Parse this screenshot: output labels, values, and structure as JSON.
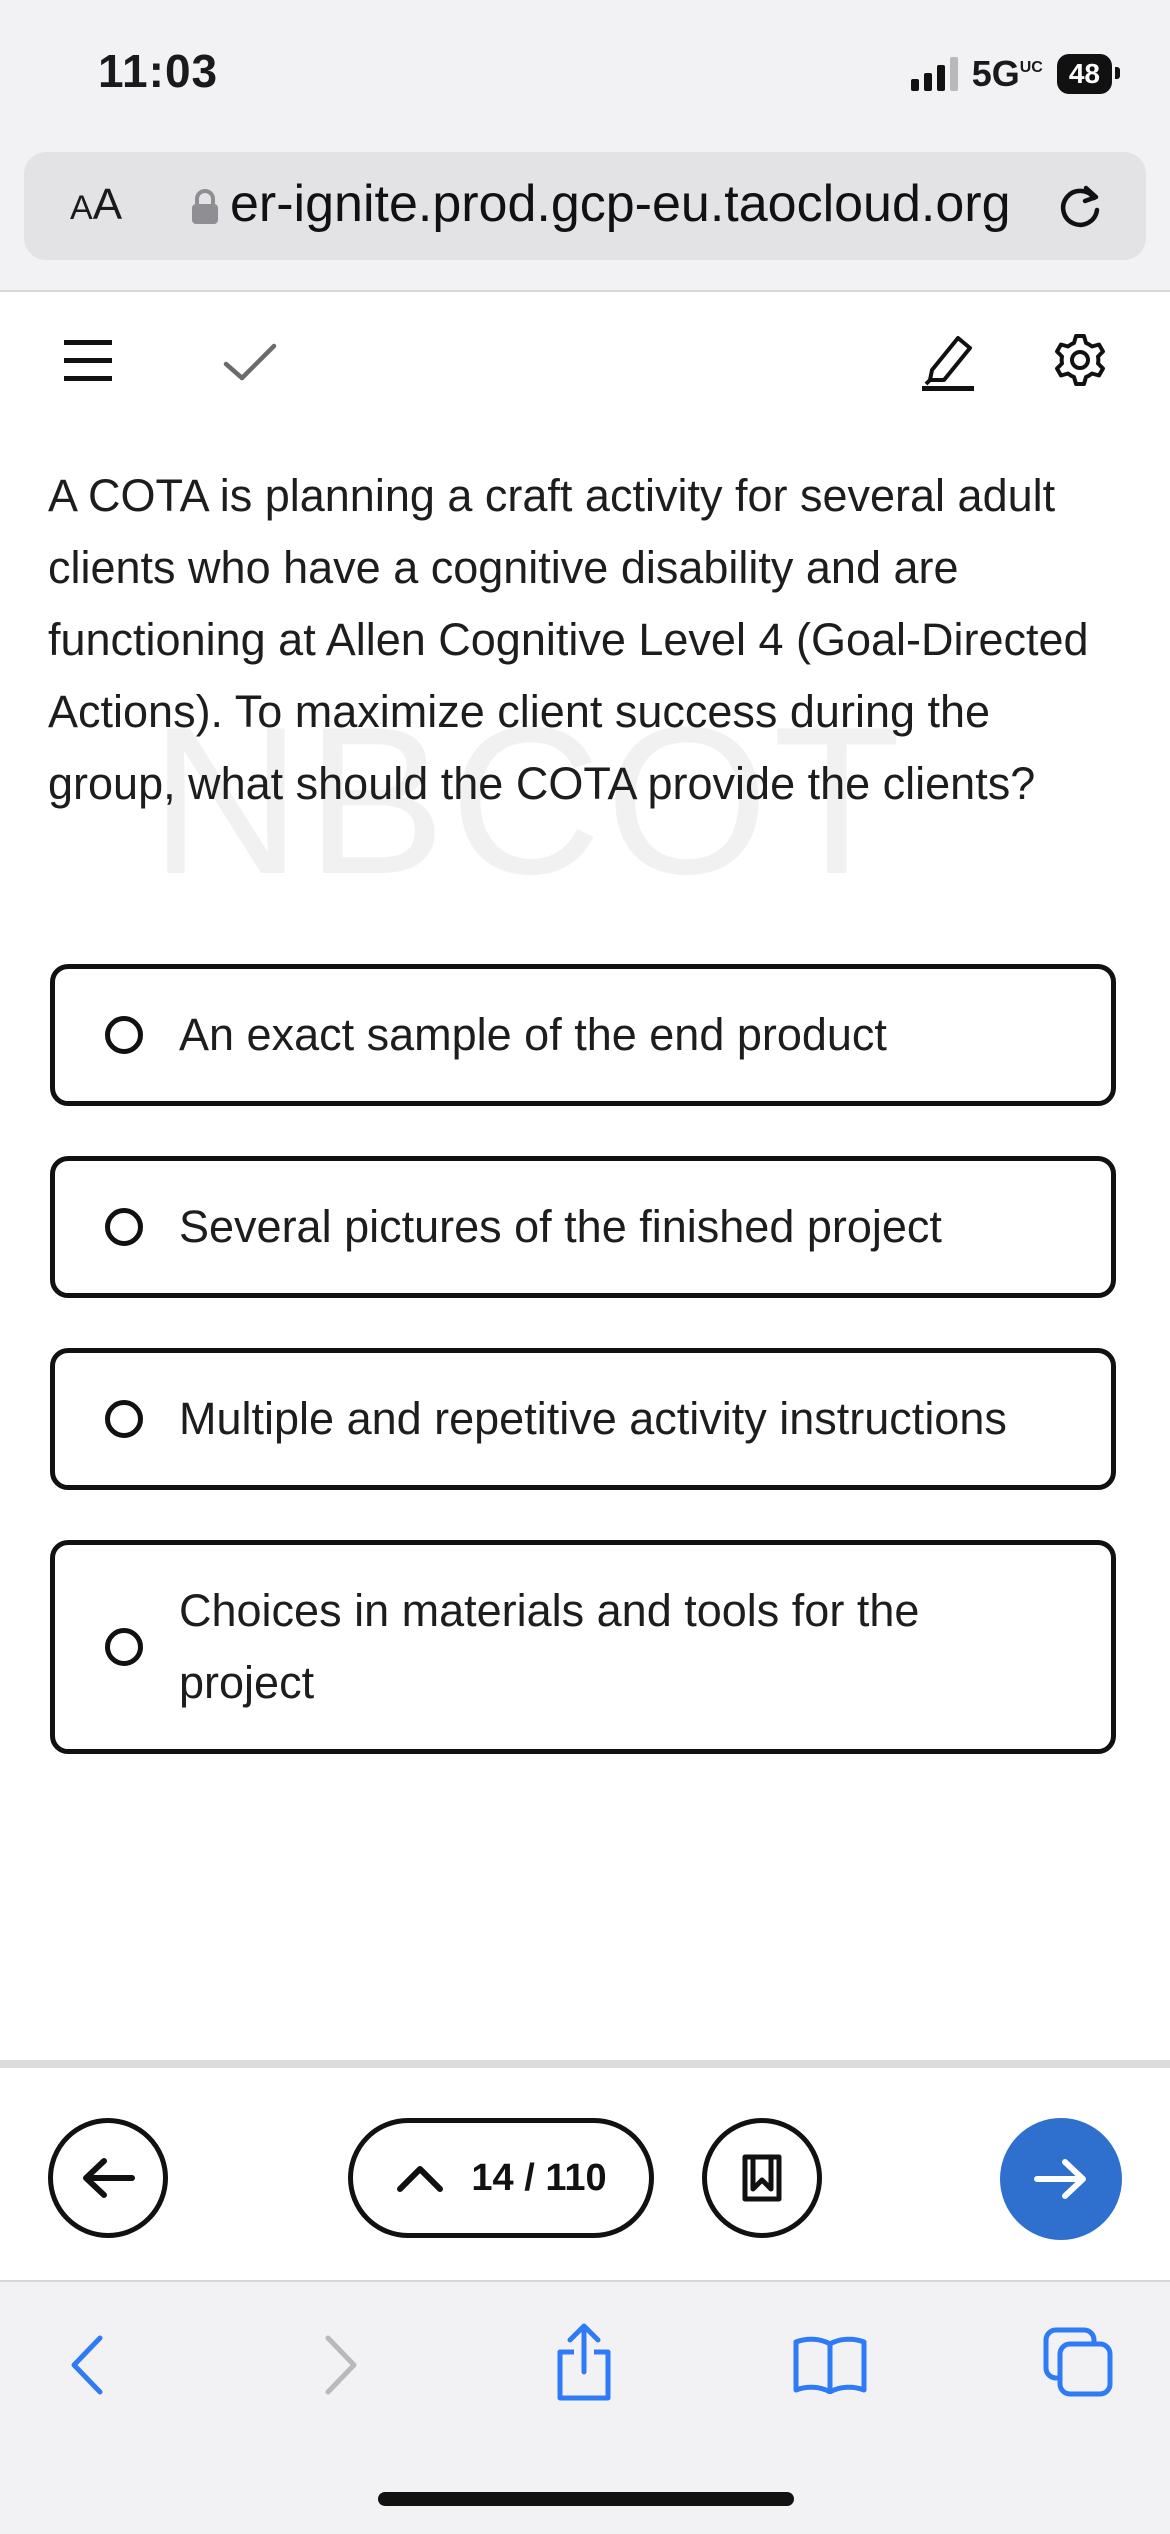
{
  "status_bar": {
    "time": "11:03",
    "network": "5G",
    "network_superscript": "UC",
    "battery": "48"
  },
  "browser": {
    "text_size_label_small": "A",
    "text_size_label_large": "A",
    "url": "er-ignite.prod.gcp-eu.taocloud.org"
  },
  "toolbar": {
    "icons": [
      "menu-icon",
      "checkmark-icon",
      "highlighter-icon",
      "gear-icon"
    ]
  },
  "question": {
    "text": "A COTA is planning a craft activity for several adult clients who have a cognitive disability and are functioning at Allen Cognitive Level 4 (Goal-Directed Actions). To maximize client success during the group, what should the COTA provide the clients?",
    "watermark": "NBCOT"
  },
  "options": [
    {
      "label": "An exact sample of the end product"
    },
    {
      "label": "Several pictures of the finished project"
    },
    {
      "label": "Multiple and repetitive activity instructions"
    },
    {
      "label": "Choices in materials and tools for the project"
    }
  ],
  "navigation": {
    "pager": "14 / 110"
  },
  "colors": {
    "next_button": "#2f6fce",
    "safari_tint": "#2f7bf6"
  }
}
